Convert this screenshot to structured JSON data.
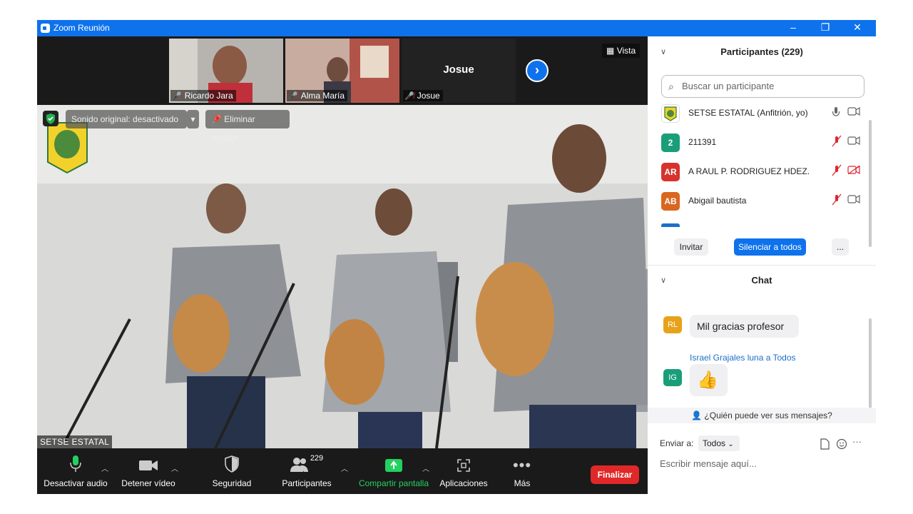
{
  "window": {
    "title": "Zoom Reunión"
  },
  "strip": {
    "tiles": [
      {
        "name": "Ricardo Jara"
      },
      {
        "name": "Alma María"
      },
      {
        "name": "Josue",
        "center_label": "Josue"
      }
    ],
    "view_label": "Vista"
  },
  "stage": {
    "original_sound": "Sonido original: desactivado",
    "unpin": "Eliminar anclaje",
    "speaker_name": "SETSE ESTATAL"
  },
  "toolbar": {
    "audio": "Desactivar audio",
    "video": "Detener vídeo",
    "security": "Seguridad",
    "participants": "Participantes",
    "participants_count": "229",
    "share": "Compartir pantalla",
    "apps": "Aplicaciones",
    "more": "Más",
    "end": "Finalizar"
  },
  "participants_panel": {
    "header": "Participantes (229)",
    "search_placeholder": "Buscar un participante",
    "items": [
      {
        "initials": "",
        "name": "SETSE ESTATAL (Anfitrión, yo)",
        "color": "#ffffff"
      },
      {
        "initials": "2",
        "name": "211391",
        "color": "#1a9e79"
      },
      {
        "initials": "AR",
        "name": "A RAUL P. RODRIGUEZ HDEZ.",
        "color": "#d6332e"
      },
      {
        "initials": "AB",
        "name": "Abigail bautista",
        "color": "#d9671f"
      }
    ],
    "invite": "Invitar",
    "mute_all": "Silenciar a todos",
    "more": "..."
  },
  "chat": {
    "header": "Chat",
    "messages": [
      {
        "initials": "RL",
        "color": "#e8a21a",
        "text": "Mil gracias profesor"
      },
      {
        "initials": "IG",
        "color": "#1a9e79",
        "sender": "Israel Grajales luna a Todos",
        "text": "👍"
      }
    ],
    "who_can_see": "¿Quién puede ver sus mensajes?",
    "send_to_label": "Enviar a:",
    "send_to_value": "Todos",
    "input_placeholder": "Escribir mensaje aquí..."
  }
}
